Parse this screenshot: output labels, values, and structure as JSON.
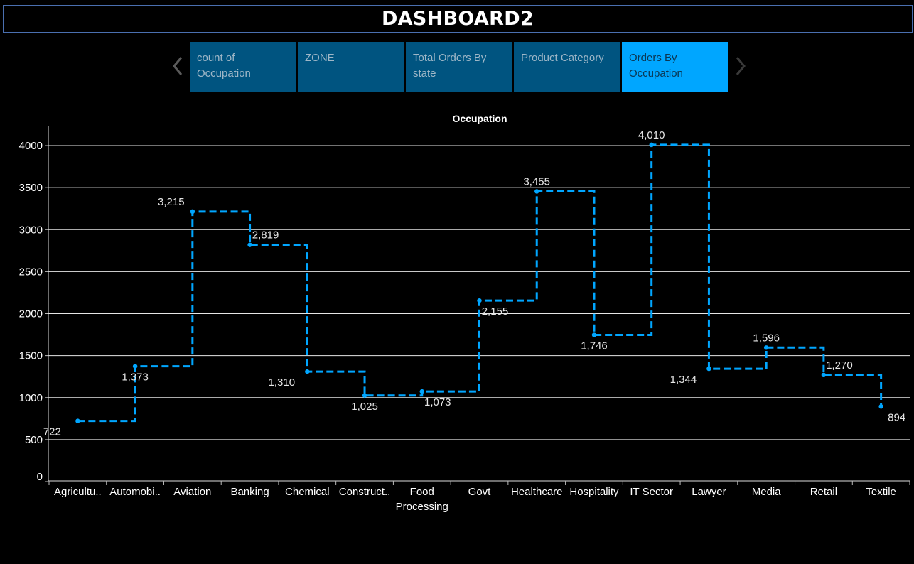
{
  "dashboard": {
    "title": "DASHBOARD2"
  },
  "tabs": [
    {
      "label": "count of Occupation",
      "active": false
    },
    {
      "label": "ZONE",
      "active": false
    },
    {
      "label": "Total Orders By state",
      "active": false
    },
    {
      "label": "Product Category",
      "active": false
    },
    {
      "label": "Orders By Occupation",
      "active": true
    }
  ],
  "nav": {
    "prev_icon": "chevron-left-icon",
    "next_icon": "chevron-right-icon"
  },
  "colors": {
    "background": "#000000",
    "line": "#00a6ff",
    "tab": "#005480",
    "tab_active": "#00a6ff"
  },
  "chart_data": {
    "type": "line",
    "line_style": "step, dashed, with markers",
    "title": "Occupation",
    "xlabel": "",
    "ylabel": "",
    "categories": [
      [
        "Agricultu.."
      ],
      [
        "Automobi.."
      ],
      [
        "Aviation"
      ],
      [
        "Banking"
      ],
      [
        "Chemical"
      ],
      [
        "Construct.."
      ],
      [
        "Food",
        "Processing"
      ],
      [
        "Govt"
      ],
      [
        "Healthcare"
      ],
      [
        "Hospitality"
      ],
      [
        "IT Sector"
      ],
      [
        "Lawyer"
      ],
      [
        "Media"
      ],
      [
        "Retail"
      ],
      [
        "Textile"
      ]
    ],
    "values": [
      722,
      1373,
      3215,
      2819,
      1310,
      1025,
      1073,
      2155,
      3455,
      1746,
      4010,
      1344,
      1596,
      1270,
      894
    ],
    "data_labels": [
      "722",
      "1,373",
      "3,215",
      "2,819",
      "1,310",
      "1,025",
      "1,073",
      "2,155",
      "3,455",
      "1,746",
      "4,010",
      "1,344",
      "1,596",
      "1,270",
      "894"
    ],
    "yticks": [
      0,
      500,
      1000,
      1500,
      2000,
      2500,
      3000,
      3500,
      4000
    ],
    "ylim": [
      0,
      4200
    ],
    "grid": true,
    "legend": "none"
  }
}
